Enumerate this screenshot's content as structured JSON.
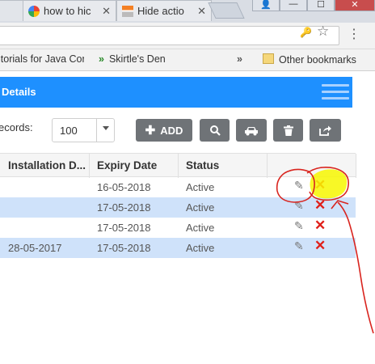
{
  "browser": {
    "tabs": [
      {
        "title": ""
      },
      {
        "title": "how to hic",
        "close": "✕"
      },
      {
        "title": "Hide actio",
        "close": "✕"
      }
    ],
    "window_controls": {
      "user": "👤",
      "minimize": "—",
      "maximize": "☐",
      "close": "✕"
    },
    "bookmarks": {
      "item1": "itorials for Java Con",
      "item2": "Skirtle's Den",
      "item2_prefix": "»",
      "more": "»",
      "other": "Other bookmarks"
    }
  },
  "app": {
    "header_title": "Details",
    "records_label": "ecords:",
    "records_value": "100",
    "add_label": "ADD",
    "columns": [
      "Installation D...",
      "Expiry Date",
      "Status"
    ],
    "rows": [
      {
        "installation": "",
        "expiry": "16-05-2018",
        "status": "Active",
        "selected": false
      },
      {
        "installation": "",
        "expiry": "17-05-2018",
        "status": "Active",
        "selected": true
      },
      {
        "installation": "",
        "expiry": "17-05-2018",
        "status": "Active",
        "selected": false
      },
      {
        "installation": "28-05-2017",
        "expiry": "17-05-2018",
        "status": "Active",
        "selected": true
      }
    ]
  },
  "colors": {
    "header_blue": "#1e90ff",
    "selected_row": "#cfe2fa",
    "delete_red": "#e0201a",
    "annotation_red": "#d9241e",
    "highlight_yellow": "#f7f700"
  }
}
